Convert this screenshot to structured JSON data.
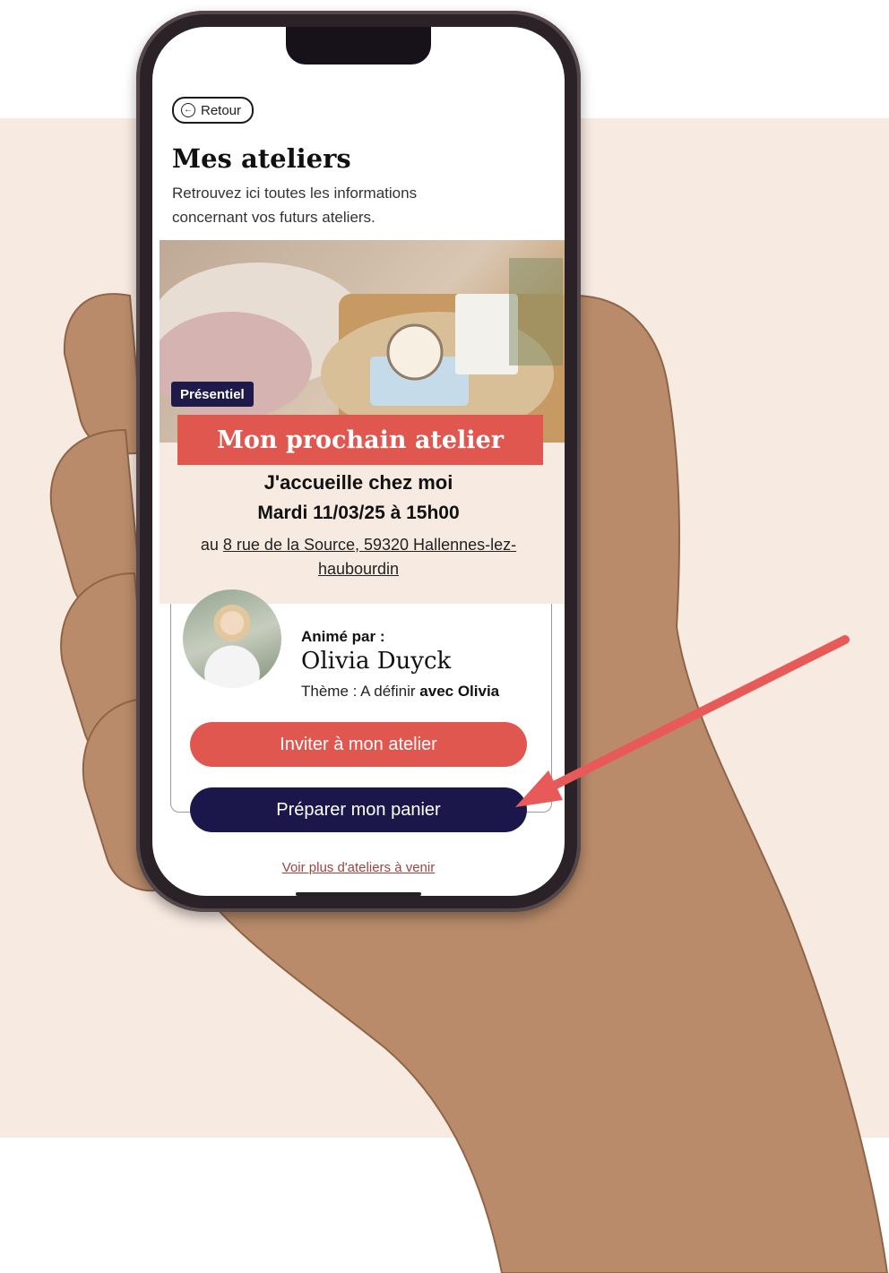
{
  "colors": {
    "background_band": "#f7eae1",
    "coral": "#e05750",
    "navy": "#1c174a",
    "link": "#a0433f",
    "arrow": "#e85a58"
  },
  "header": {
    "back_label": "Retour",
    "back_icon": "circle-arrow-left-icon",
    "title": "Mes ateliers",
    "subtitle": "Retrouvez ici toutes les informations concernant vos futurs ateliers."
  },
  "event": {
    "badge": "Présentiel",
    "banner": "Mon prochain atelier",
    "name": "J'accueille chez moi",
    "date": "Mardi 11/03/25 à 15h00",
    "address_prefix": "au ",
    "address": "8 rue de la Source, 59320 Hallennes-lez-haubourdin"
  },
  "host": {
    "label": "Animé par :",
    "name": "Olivia Duyck",
    "theme_prefix": "Thème : A définir ",
    "theme_suffix": "avec Olivia"
  },
  "actions": {
    "invite": "Inviter à mon atelier",
    "prepare": "Préparer mon panier",
    "more": "Voir plus d'ateliers à venir"
  }
}
